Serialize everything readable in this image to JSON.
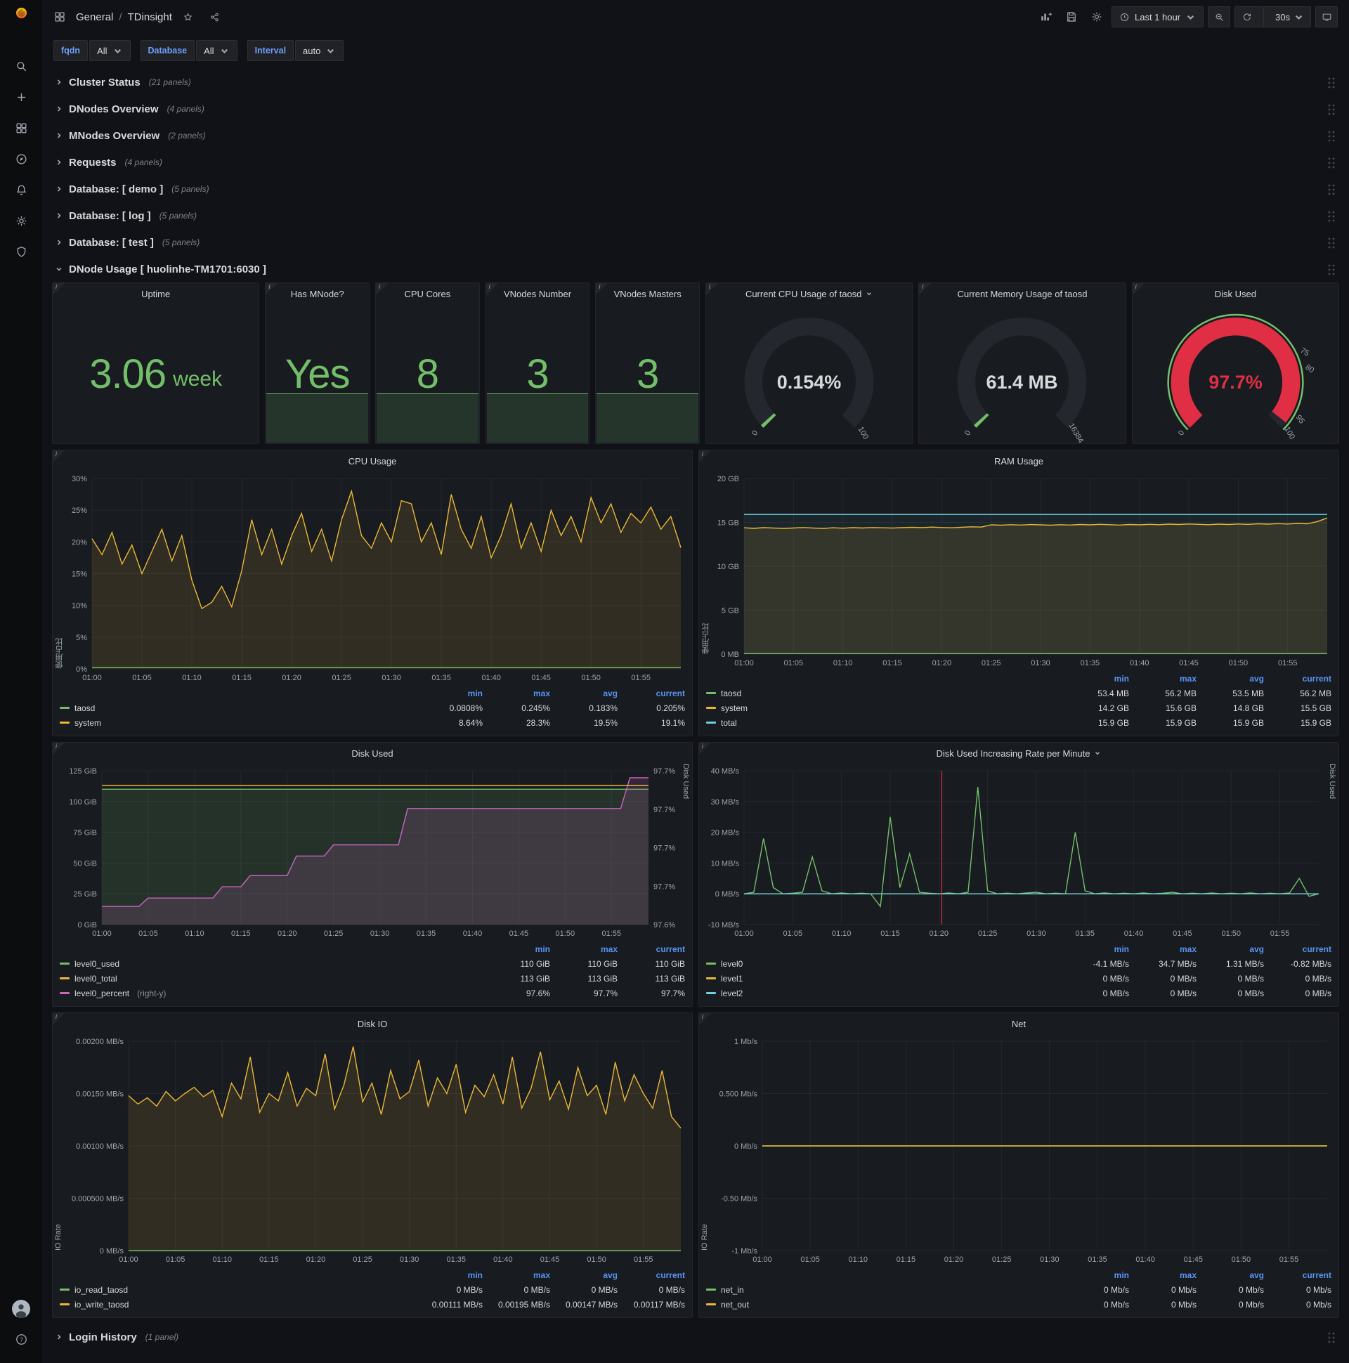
{
  "colors": {
    "bg": "#111217",
    "chrome": "#0b0d0f",
    "panel": "#181b1f",
    "panel_border": "#22252b",
    "text": "#d8d9da",
    "muted": "#8e949e",
    "blue": "#5794f2",
    "link_blue": "#6e9fff",
    "green": "#73bf69",
    "yellow": "#eab839",
    "cyan": "#6ed0e0",
    "pink": "#cb66c0",
    "red": "#e02f44",
    "grid": "rgba(204,204,220,0.07)"
  },
  "sidebar": {
    "icons": [
      "grafana-logo",
      "search",
      "create",
      "dashboards",
      "explore",
      "alerting",
      "configuration",
      "server-admin"
    ],
    "bottom_icons": [
      "user-avatar",
      "help"
    ]
  },
  "topnav": {
    "breadcrumb_root": "General",
    "breadcrumb_sep": "/",
    "breadcrumb_current": "TDinsight",
    "time_range_label": "Last 1 hour",
    "refresh_interval_label": "30s"
  },
  "filters": [
    {
      "label": "fqdn",
      "value": "All"
    },
    {
      "label": "Database",
      "value": "All"
    },
    {
      "label": "Interval",
      "value": "auto"
    }
  ],
  "rows_top": [
    {
      "title": "Cluster Status",
      "count": "(21 panels)"
    },
    {
      "title": "DNodes Overview",
      "count": "(4 panels)"
    },
    {
      "title": "MNodes Overview",
      "count": "(2 panels)"
    },
    {
      "title": "Requests",
      "count": "(4 panels)"
    },
    {
      "title": "Database: [ demo ]",
      "count": "(5 panels)"
    },
    {
      "title": "Database: [ log ]",
      "count": "(5 panels)"
    },
    {
      "title": "Database: [ test ]",
      "count": "(5 panels)"
    }
  ],
  "expanded_row": {
    "title": "DNode Usage [ huolinhe-TM1701:6030 ]"
  },
  "rows_bottom": [
    {
      "title": "Login History",
      "count": "(1 panel)"
    }
  ],
  "stats": [
    {
      "title": "Uptime",
      "value": "3.06",
      "unit": "week",
      "sparkline": false,
      "wide": true
    },
    {
      "title": "Has MNode?",
      "value": "Yes",
      "sparkline": true
    },
    {
      "title": "CPU Cores",
      "value": "8",
      "sparkline": true
    },
    {
      "title": "VNodes Number",
      "value": "3",
      "sparkline": true
    },
    {
      "title": "VNodes Masters",
      "value": "3",
      "sparkline": true
    }
  ],
  "gauges": [
    {
      "title": "Current CPU Usage of taosd",
      "dropdown": true,
      "value": "0.154%",
      "value_color": "#d8d9da",
      "frac": 0.00154,
      "bar_color": "#73bf69",
      "ticks": [
        {
          "label": "0",
          "pos": 0
        },
        {
          "label": "100",
          "pos": 1
        }
      ]
    },
    {
      "title": "Current Memory Usage of taosd",
      "value": "61.4 MB",
      "value_color": "#d8d9da",
      "frac": 0.0037,
      "bar_color": "#73bf69",
      "ticks": [
        {
          "label": "0",
          "pos": 0
        },
        {
          "label": "16384",
          "pos": 1
        }
      ]
    },
    {
      "title": "Disk Used",
      "value": "97.7%",
      "value_color": "#e02f44",
      "frac": 0.977,
      "bar_color": "#e02f44",
      "outer_ring": "#73bf69",
      "ticks": [
        {
          "label": "0",
          "pos": 0
        },
        {
          "label": "75",
          "pos": 0.75
        },
        {
          "label": "80",
          "pos": 0.8
        },
        {
          "label": "95",
          "pos": 0.95
        },
        {
          "label": "100",
          "pos": 1
        }
      ]
    }
  ],
  "x_ticks": [
    "01:00",
    "01:05",
    "01:10",
    "01:15",
    "01:20",
    "01:25",
    "01:30",
    "01:35",
    "01:40",
    "01:45",
    "01:50",
    "01:55"
  ],
  "charts": [
    {
      "title": "CPU Usage",
      "y_label": "使用占比",
      "pad_left": 56,
      "pad_right": 16,
      "ymin": 0,
      "ymax": 30,
      "y_ticks": [
        "30%",
        "25%",
        "20%",
        "15%",
        "10%",
        "5%",
        "0%"
      ],
      "series": [
        {
          "name": "system",
          "color": "#eab839",
          "fill": 0.12,
          "values": [
            20.5,
            18,
            21.5,
            16.5,
            19.5,
            15,
            18.5,
            22,
            17,
            21,
            14,
            9.5,
            10.5,
            13,
            9.8,
            15.5,
            23.5,
            18,
            22,
            16.5,
            21,
            24.5,
            18.5,
            22,
            17,
            23.5,
            28,
            21,
            19,
            23,
            20,
            26.5,
            26,
            20,
            23,
            18,
            27.5,
            22,
            19,
            24,
            17.5,
            21,
            26,
            19,
            23,
            18.5,
            25,
            21,
            24,
            20,
            27,
            23,
            26,
            21.5,
            24.5,
            23,
            25.5,
            22,
            24,
            19.1
          ]
        },
        {
          "name": "taosd",
          "color": "#73bf69",
          "const": 0.2
        }
      ],
      "legend": {
        "cols": [
          "min",
          "max",
          "avg",
          "current"
        ],
        "rows": [
          {
            "name": "taosd",
            "color": "#73bf69",
            "vals": [
              "0.0808%",
              "0.245%",
              "0.183%",
              "0.205%"
            ]
          },
          {
            "name": "system",
            "color": "#eab839",
            "vals": [
              "8.64%",
              "28.3%",
              "19.5%",
              "19.1%"
            ]
          }
        ]
      }
    },
    {
      "title": "RAM Usage",
      "y_label": "使用占比",
      "pad_left": 64,
      "pad_right": 16,
      "ymin": 0,
      "ymax": 20,
      "y_ticks": [
        "20 GB",
        "15 GB",
        "10 GB",
        "5 GB",
        "0 MB"
      ],
      "series": [
        {
          "name": "total",
          "color": "#6ed0e0",
          "fill": 0.06,
          "const": 15.9
        },
        {
          "name": "system",
          "color": "#eab839",
          "fill": 0.12,
          "values": [
            14.38,
            14.32,
            14.4,
            14.35,
            14.3,
            14.36,
            14.42,
            14.35,
            14.3,
            14.38,
            14.34,
            14.4,
            14.36,
            14.42,
            14.38,
            14.35,
            14.4,
            14.44,
            14.4,
            14.46,
            14.42,
            14.38,
            14.44,
            14.5,
            14.46,
            14.72,
            14.68,
            14.74,
            14.7,
            14.75,
            14.72,
            14.68,
            14.74,
            14.7,
            14.76,
            14.72,
            14.78,
            14.74,
            14.7,
            14.76,
            14.72,
            14.78,
            14.74,
            14.8,
            14.76,
            14.82,
            14.78,
            14.74,
            14.8,
            14.76,
            14.82,
            14.78,
            14.84,
            14.8,
            14.86,
            14.82,
            14.88,
            14.84,
            15.1,
            15.5
          ]
        },
        {
          "name": "taosd",
          "color": "#73bf69",
          "const": 0.055
        }
      ],
      "legend": {
        "cols": [
          "min",
          "max",
          "avg",
          "current"
        ],
        "rows": [
          {
            "name": "taosd",
            "color": "#73bf69",
            "vals": [
              "53.4 MB",
              "56.2 MB",
              "53.5 MB",
              "56.2 MB"
            ]
          },
          {
            "name": "system",
            "color": "#eab839",
            "vals": [
              "14.2 GB",
              "15.6 GB",
              "14.8 GB",
              "15.5 GB"
            ]
          },
          {
            "name": "total",
            "color": "#6ed0e0",
            "vals": [
              "15.9 GB",
              "15.9 GB",
              "15.9 GB",
              "15.9 GB"
            ]
          }
        ]
      }
    },
    {
      "title": "Disk Used",
      "pad_left": 70,
      "pad_right": 62,
      "ymin": 0,
      "ymax": 125,
      "y_ticks": [
        "125 GiB",
        "100 GiB",
        "75 GiB",
        "50 GiB",
        "25 GiB",
        "0 GiB"
      ],
      "y2min": 97.595,
      "y2max": 97.705,
      "y2_ticks": [
        "97.7%",
        "97.7%",
        "97.7%",
        "97.7%",
        "97.6%"
      ],
      "y2_label": "Disk Used",
      "series": [
        {
          "name": "level0_used",
          "color": "#73bf69",
          "fill": 0.14,
          "const": 110
        },
        {
          "name": "level0_percent",
          "color": "#cb66c0",
          "fill": 0.16,
          "axis": "right",
          "values": [
            97.608,
            97.608,
            97.608,
            97.608,
            97.608,
            97.614,
            97.614,
            97.614,
            97.614,
            97.614,
            97.614,
            97.614,
            97.614,
            97.622,
            97.622,
            97.622,
            97.63,
            97.63,
            97.63,
            97.63,
            97.63,
            97.644,
            97.644,
            97.644,
            97.644,
            97.652,
            97.652,
            97.652,
            97.652,
            97.652,
            97.652,
            97.652,
            97.652,
            97.678,
            97.678,
            97.678,
            97.678,
            97.678,
            97.678,
            97.678,
            97.678,
            97.678,
            97.678,
            97.678,
            97.678,
            97.678,
            97.678,
            97.678,
            97.678,
            97.678,
            97.678,
            97.678,
            97.678,
            97.678,
            97.678,
            97.678,
            97.678,
            97.7,
            97.7,
            97.7
          ]
        },
        {
          "name": "level0_total",
          "color": "#eab839",
          "const": 113
        }
      ],
      "legend": {
        "cols": [
          "min",
          "max",
          "current"
        ],
        "rows": [
          {
            "name": "level0_used",
            "color": "#73bf69",
            "vals": [
              "110 GiB",
              "110 GiB",
              "110 GiB"
            ]
          },
          {
            "name": "level0_total",
            "color": "#eab839",
            "vals": [
              "113 GiB",
              "113 GiB",
              "113 GiB"
            ]
          },
          {
            "name": "level0_percent",
            "suffix": "(right-y)",
            "color": "#cb66c0",
            "vals": [
              "97.6%",
              "97.7%",
              "97.7%"
            ]
          }
        ]
      }
    },
    {
      "title": "Disk Used Increasing Rate per Minute",
      "dropdown": true,
      "pad_left": 64,
      "pad_right": 28,
      "ymin": -10,
      "ymax": 40,
      "y_ticks": [
        "40 MB/s",
        "30 MB/s",
        "20 MB/s",
        "10 MB/s",
        "0 MB/s",
        "-10 MB/s"
      ],
      "y2_label": "Disk Used",
      "annotation_x": 20.3,
      "series": [
        {
          "name": "level0",
          "color": "#73bf69",
          "values": [
            0,
            0.5,
            18,
            2,
            0,
            0.2,
            0.5,
            12,
            1,
            0,
            0.3,
            0,
            0.2,
            0,
            -4.1,
            25,
            2,
            13,
            0.5,
            0.2,
            0,
            0.3,
            0,
            0.5,
            34.7,
            1,
            0,
            0.2,
            0,
            0.3,
            0.5,
            0,
            0.2,
            0,
            20,
            1,
            0,
            0.3,
            0,
            0.2,
            0,
            0.3,
            0,
            0.2,
            0.5,
            0,
            0.2,
            0,
            0.3,
            0,
            0.2,
            0,
            0.3,
            0,
            0.2,
            0,
            0.3,
            5,
            -0.82,
            0
          ]
        },
        {
          "name": "level1",
          "color": "#eab839",
          "const": 0
        },
        {
          "name": "level2",
          "color": "#6ed0e0",
          "const": 0
        }
      ],
      "legend": {
        "cols": [
          "min",
          "max",
          "avg",
          "current"
        ],
        "rows": [
          {
            "name": "level0",
            "color": "#73bf69",
            "vals": [
              "-4.1 MB/s",
              "34.7 MB/s",
              "1.31 MB/s",
              "-0.82 MB/s"
            ]
          },
          {
            "name": "level1",
            "color": "#eab839",
            "vals": [
              "0 MB/s",
              "0 MB/s",
              "0 MB/s",
              "0 MB/s"
            ]
          },
          {
            "name": "level2",
            "color": "#6ed0e0",
            "vals": [
              "0 MB/s",
              "0 MB/s",
              "0 MB/s",
              "0 MB/s"
            ]
          }
        ]
      }
    },
    {
      "title": "Disk IO",
      "y_label": "IO Rate",
      "pad_left": 108,
      "pad_right": 16,
      "ymin": 0,
      "ymax": 0.002,
      "y_ticks": [
        "0.00200 MB/s",
        "0.00150 MB/s",
        "0.00100 MB/s",
        "0.000500 MB/s",
        "0 MB/s"
      ],
      "series": [
        {
          "name": "io_write_taosd",
          "color": "#eab839",
          "fill": 0.12,
          "values": [
            0.00148,
            0.0014,
            0.00146,
            0.00138,
            0.00152,
            0.00143,
            0.0015,
            0.00156,
            0.00147,
            0.00153,
            0.00128,
            0.0016,
            0.00145,
            0.00185,
            0.00132,
            0.0015,
            0.00143,
            0.0017,
            0.00138,
            0.00155,
            0.00148,
            0.00188,
            0.00135,
            0.00158,
            0.00195,
            0.00142,
            0.0016,
            0.0013,
            0.00172,
            0.00145,
            0.00152,
            0.00182,
            0.00138,
            0.00165,
            0.0015,
            0.00178,
            0.00132,
            0.00158,
            0.00147,
            0.00168,
            0.0014,
            0.00185,
            0.00136,
            0.00155,
            0.0019,
            0.00144,
            0.00162,
            0.00135,
            0.00175,
            0.00148,
            0.00158,
            0.0013,
            0.0018,
            0.00143,
            0.00168,
            0.0015,
            0.00136,
            0.00172,
            0.00128,
            0.00117
          ]
        },
        {
          "name": "io_read_taosd",
          "color": "#73bf69",
          "const": 0
        }
      ],
      "legend": {
        "cols": [
          "min",
          "max",
          "avg",
          "current"
        ],
        "rows": [
          {
            "name": "io_read_taosd",
            "color": "#73bf69",
            "vals": [
              "0 MB/s",
              "0 MB/s",
              "0 MB/s",
              "0 MB/s"
            ]
          },
          {
            "name": "io_write_taosd",
            "color": "#eab839",
            "vals": [
              "0.00111 MB/s",
              "0.00195 MB/s",
              "0.00147 MB/s",
              "0.00117 MB/s"
            ]
          }
        ]
      }
    },
    {
      "title": "Net",
      "y_label": "IO Rate",
      "pad_left": 90,
      "pad_right": 16,
      "ymin": -1,
      "ymax": 1,
      "y_ticks": [
        "1 Mb/s",
        "0.500 Mb/s",
        "0 Mb/s",
        "-0.50 Mb/s",
        "-1 Mb/s"
      ],
      "series": [
        {
          "name": "net_in",
          "color": "#73bf69",
          "const": 0
        },
        {
          "name": "net_out",
          "color": "#eab839",
          "const": 0
        }
      ],
      "legend": {
        "cols": [
          "min",
          "max",
          "avg",
          "current"
        ],
        "rows": [
          {
            "name": "net_in",
            "color": "#73bf69",
            "vals": [
              "0 Mb/s",
              "0 Mb/s",
              "0 Mb/s",
              "0 Mb/s"
            ]
          },
          {
            "name": "net_out",
            "color": "#eab839",
            "vals": [
              "0 Mb/s",
              "0 Mb/s",
              "0 Mb/s",
              "0 Mb/s"
            ]
          }
        ]
      }
    }
  ]
}
